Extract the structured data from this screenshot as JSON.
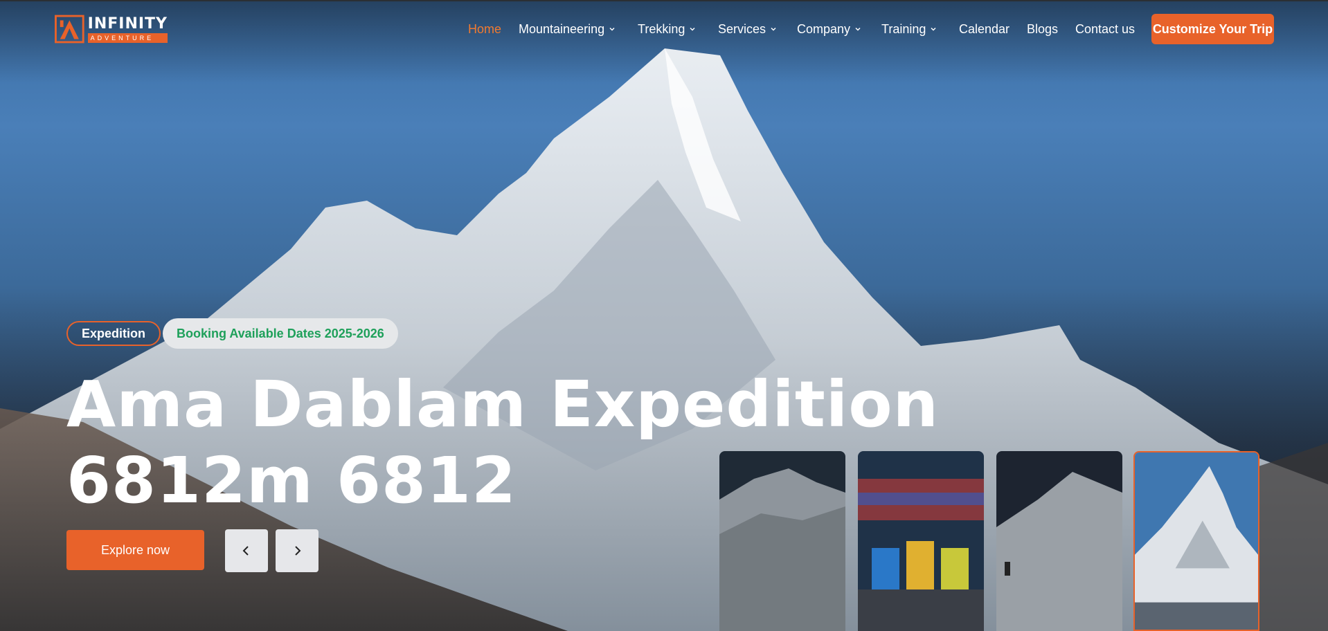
{
  "brand": {
    "name": "INFINITY",
    "tagline": "ADVENTURE",
    "accent": "#e8622a"
  },
  "nav": {
    "items": [
      {
        "label": "Home",
        "active": true,
        "dropdown": false
      },
      {
        "label": "Mountaineering",
        "dropdown": true
      },
      {
        "label": "Trekking",
        "dropdown": true
      },
      {
        "label": "Services",
        "dropdown": true
      },
      {
        "label": "Company",
        "dropdown": true
      },
      {
        "label": "Training",
        "dropdown": true
      },
      {
        "label": "Calendar",
        "dropdown": false
      },
      {
        "label": "Blogs",
        "dropdown": false
      },
      {
        "label": "Contact us",
        "dropdown": false
      }
    ],
    "cta_label": "Customize Your Trip"
  },
  "hero": {
    "tag": "Expedition",
    "booking": "Booking Available Dates 2025-2026",
    "title": "Ama Dablam Expedition 6812m 6812",
    "explore_label": "Explore now",
    "prev_icon": "chevron-left-icon",
    "next_icon": "chevron-right-icon",
    "active_slide": 4,
    "thumbnails": [
      "snowy-slope",
      "group-photo",
      "climber-on-snow",
      "ama-dablam-peak"
    ]
  }
}
